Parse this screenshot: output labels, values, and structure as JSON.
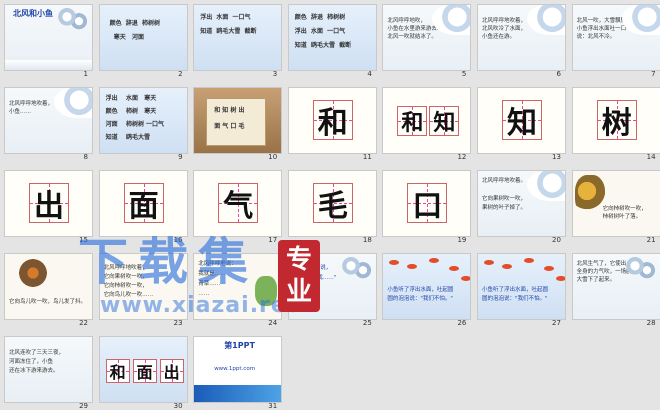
{
  "slides": [
    {
      "num": "1",
      "kind": "cover",
      "title": "北风和小鱼",
      "sub": "新人教版小学语文一年级上册"
    },
    {
      "num": "2",
      "kind": "wordsA",
      "lines": [
        "颜色  辞退  柿树树",
        "  寒天   河面"
      ]
    },
    {
      "num": "3",
      "kind": "wordsB",
      "lines": [
        "浮出  水面  一口气",
        "知道  鸥毛大雪  截断",
        " "
      ]
    },
    {
      "num": "4",
      "kind": "wordsB",
      "lines": [
        "颜色  辞退  柿树树",
        "浮出  水面  一口气",
        "知道  鸥毛大雪  截断"
      ]
    },
    {
      "num": "5",
      "kind": "textB",
      "lines": [
        "北风呼呼地吹，",
        "小鱼在水里游来游去……",
        "北风一吹就结冰了。"
      ]
    },
    {
      "num": "6",
      "kind": "textB",
      "lines": [
        "北风呼呼地吹着，",
        "北风吹冷了水面，",
        "小鱼还在游。"
      ]
    },
    {
      "num": "7",
      "kind": "textB",
      "lines": [
        "北风一吹，大雪飘飘，",
        "小鱼浮出水面吐一口气，",
        "说：北风不冷。"
      ]
    },
    {
      "num": "8",
      "kind": "textB",
      "lines": [
        "北风呼呼地吹着，",
        "小鱼……",
        " "
      ]
    },
    {
      "num": "9",
      "kind": "wordsC",
      "lines": [
        "浮出    水面   寒天",
        "颜色    柿树   寒天",
        "河面    柿树树 一口气",
        "知道    鸥毛大雪"
      ]
    },
    {
      "num": "10",
      "kind": "scroll",
      "lines": [
        "和 知 树 出",
        "面 气 口 毛"
      ]
    },
    {
      "num": "11",
      "kind": "char",
      "char": "和"
    },
    {
      "num": "12",
      "kind": "char2",
      "chars": [
        "和",
        "知"
      ]
    },
    {
      "num": "13",
      "kind": "char",
      "char": "知"
    },
    {
      "num": "14",
      "kind": "char",
      "char": "树"
    },
    {
      "num": "15",
      "kind": "char",
      "char": "出"
    },
    {
      "num": "16",
      "kind": "char",
      "char": "面"
    },
    {
      "num": "17",
      "kind": "char",
      "char": "气"
    },
    {
      "num": "18",
      "kind": "char",
      "char": "毛"
    },
    {
      "num": "19",
      "kind": "char",
      "char": "口"
    },
    {
      "num": "20",
      "kind": "snowtext",
      "lines": [
        "北风呼呼地吹着。",
        "",
        "它向果树吹一吹，",
        "果树的叶子掉了。"
      ]
    },
    {
      "num": "21",
      "kind": "treetext",
      "lines": [
        "它向柿树吹一吹，",
        "柿树树叶了落。"
      ]
    },
    {
      "num": "22",
      "kind": "nest",
      "lines": [
        "它向鸟儿吹一吹，鸟儿发了抖。"
      ]
    },
    {
      "num": "23",
      "kind": "textC",
      "lines": [
        "北风呼呼地吹着，",
        "它向果树吹一吹，",
        "它向柿树吹一吹，",
        "它向鸟儿吹一吹……"
      ]
    },
    {
      "num": "24",
      "kind": "textD",
      "lines": [
        "北风呼呼地说：",
        "我就是……",
        "青草……",
        "……"
      ]
    },
    {
      "num": "25",
      "kind": "textE",
      "lines": [
        "小鱼快乐地说，",
        "\"大家都怕我……\""
      ]
    },
    {
      "num": "26",
      "kind": "fish",
      "lines": [
        "小鱼听了浮出水面，吐起圆",
        "圆的泡泡说：\"我们不怕。\""
      ]
    },
    {
      "num": "27",
      "kind": "fish",
      "lines": [
        "小鱼听了浮出水面，吐起圆",
        "圆的泡泡说：\"我们不怕。\""
      ]
    },
    {
      "num": "28",
      "kind": "snowtext2",
      "lines": [
        "北风生气了，它使出",
        "全身的力气吹，一场鸥毛",
        "大雪下了起来。"
      ]
    },
    {
      "num": "29",
      "kind": "textF",
      "lines": [
        "北风连吹了三天三夜，",
        "河面冻住了，小鱼",
        "还在冰下游来游去。"
      ]
    },
    {
      "num": "30",
      "kind": "char3",
      "chars": [
        "和",
        "面",
        "出"
      ]
    },
    {
      "num": "31",
      "kind": "ending",
      "title": "第1PPT",
      "lines": [
        "www.1ppt.com"
      ]
    }
  ],
  "watermark": {
    "title": "下载集",
    "seal": "专业",
    "url": "www.xiazai.red"
  }
}
